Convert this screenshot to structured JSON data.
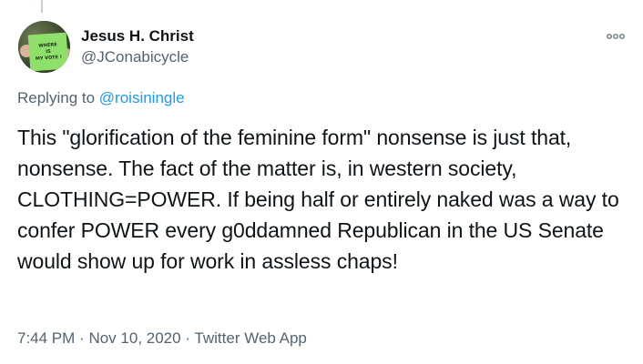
{
  "author": {
    "display_name": "Jesus H. Christ",
    "handle": "@JConabicycle",
    "avatar_sign_lines": [
      "WHERE",
      "IS",
      "MY VOTE !"
    ]
  },
  "reply": {
    "prefix": "Replying to",
    "mention": "@roisiningle"
  },
  "tweet": {
    "text": "This \"glorification of the feminine form\" nonsense is just that, nonsense. The fact of the matter is, in western society, CLOTHING=POWER. If being half or entirely naked was a way to confer POWER every g0ddamned Republican in the US Senate would show up for work in assless chaps!"
  },
  "meta": {
    "time": "7:44 PM",
    "separator": "·",
    "date": "Nov 10, 2020",
    "source": "Twitter Web App"
  },
  "icons": {
    "more": "more-options-icon"
  },
  "colors": {
    "text": "#0f1419",
    "secondary": "#536471",
    "link": "#1d9bf0",
    "thread_line": "#c4cfd6"
  }
}
